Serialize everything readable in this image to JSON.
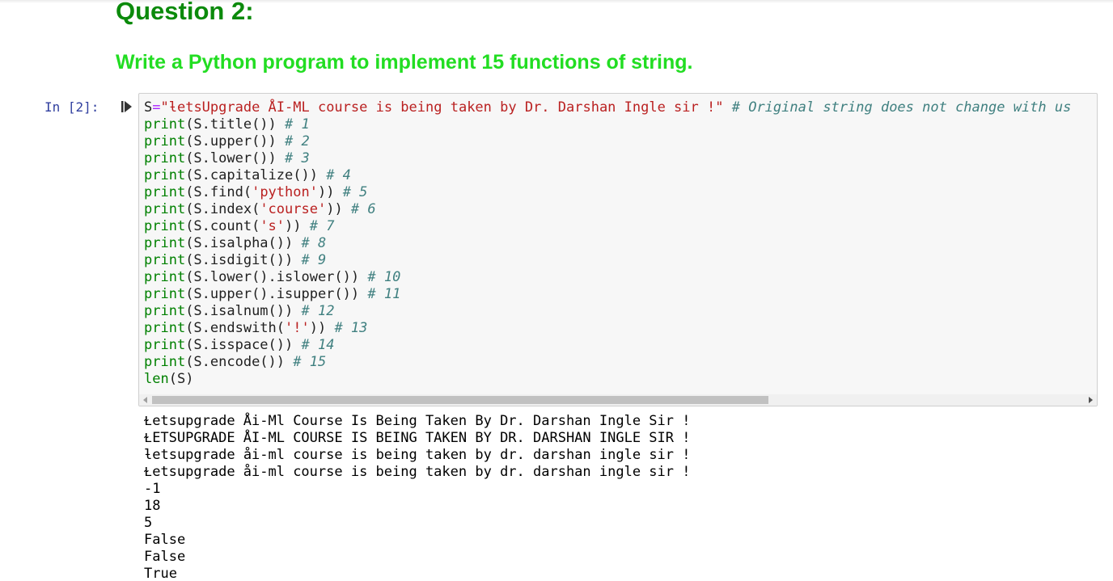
{
  "colors": {
    "heading_question": "#0b8a0b",
    "heading_task": "#22dd22",
    "prompt": "#303f9f",
    "keyword": "#aa22ff",
    "builtin": "#008000",
    "string": "#ba2121",
    "comment": "#408080",
    "text": "#212121",
    "output": "#000000"
  },
  "headings": {
    "question": "Question 2:",
    "task": "Write a Python program to implement 15 functions of string."
  },
  "cell": {
    "prompt": "In [2]:",
    "run_icon": "run-cell-icon",
    "code_lines": [
      [
        {
          "text": "S",
          "type": "text"
        },
        {
          "text": "=",
          "type": "keyword"
        },
        {
          "text": "\"ƚetsUpgrade ÅI-ML course is being taken by Dr. Darshan Ingle sir !\"",
          "type": "string"
        },
        {
          "text": " ",
          "type": "text"
        },
        {
          "text": "# Original string does not change with us",
          "type": "comment"
        }
      ],
      [
        {
          "text": "print",
          "type": "builtin"
        },
        {
          "text": "(S.title()) ",
          "type": "text"
        },
        {
          "text": "# 1",
          "type": "comment"
        }
      ],
      [
        {
          "text": "print",
          "type": "builtin"
        },
        {
          "text": "(S.upper()) ",
          "type": "text"
        },
        {
          "text": "# 2",
          "type": "comment"
        }
      ],
      [
        {
          "text": "print",
          "type": "builtin"
        },
        {
          "text": "(S.lower()) ",
          "type": "text"
        },
        {
          "text": "# 3",
          "type": "comment"
        }
      ],
      [
        {
          "text": "print",
          "type": "builtin"
        },
        {
          "text": "(S.capitalize()) ",
          "type": "text"
        },
        {
          "text": "# 4",
          "type": "comment"
        }
      ],
      [
        {
          "text": "print",
          "type": "builtin"
        },
        {
          "text": "(S.find(",
          "type": "text"
        },
        {
          "text": "'python'",
          "type": "string"
        },
        {
          "text": ")) ",
          "type": "text"
        },
        {
          "text": "# 5",
          "type": "comment"
        }
      ],
      [
        {
          "text": "print",
          "type": "builtin"
        },
        {
          "text": "(S.index(",
          "type": "text"
        },
        {
          "text": "'course'",
          "type": "string"
        },
        {
          "text": ")) ",
          "type": "text"
        },
        {
          "text": "# 6",
          "type": "comment"
        }
      ],
      [
        {
          "text": "print",
          "type": "builtin"
        },
        {
          "text": "(S.count(",
          "type": "text"
        },
        {
          "text": "'s'",
          "type": "string"
        },
        {
          "text": ")) ",
          "type": "text"
        },
        {
          "text": "# 7",
          "type": "comment"
        }
      ],
      [
        {
          "text": "print",
          "type": "builtin"
        },
        {
          "text": "(S.isalpha()) ",
          "type": "text"
        },
        {
          "text": "# 8",
          "type": "comment"
        }
      ],
      [
        {
          "text": "print",
          "type": "builtin"
        },
        {
          "text": "(S.isdigit()) ",
          "type": "text"
        },
        {
          "text": "# 9",
          "type": "comment"
        }
      ],
      [
        {
          "text": "print",
          "type": "builtin"
        },
        {
          "text": "(S.lower().islower()) ",
          "type": "text"
        },
        {
          "text": "# 10",
          "type": "comment"
        }
      ],
      [
        {
          "text": "print",
          "type": "builtin"
        },
        {
          "text": "(S.upper().isupper()) ",
          "type": "text"
        },
        {
          "text": "# 11",
          "type": "comment"
        }
      ],
      [
        {
          "text": "print",
          "type": "builtin"
        },
        {
          "text": "(S.isalnum()) ",
          "type": "text"
        },
        {
          "text": "# 12",
          "type": "comment"
        }
      ],
      [
        {
          "text": "print",
          "type": "builtin"
        },
        {
          "text": "(S.endswith(",
          "type": "text"
        },
        {
          "text": "'!'",
          "type": "string"
        },
        {
          "text": ")) ",
          "type": "text"
        },
        {
          "text": "# 13",
          "type": "comment"
        }
      ],
      [
        {
          "text": "print",
          "type": "builtin"
        },
        {
          "text": "(S.isspace()) ",
          "type": "text"
        },
        {
          "text": "# 14",
          "type": "comment"
        }
      ],
      [
        {
          "text": "print",
          "type": "builtin"
        },
        {
          "text": "(S.encode()) ",
          "type": "text"
        },
        {
          "text": "# 15",
          "type": "comment"
        }
      ],
      [
        {
          "text": "len",
          "type": "builtin"
        },
        {
          "text": "(S)",
          "type": "text"
        }
      ]
    ],
    "scrollbar": {
      "left_arrow": "scroll-left-icon",
      "right_arrow": "scroll-right-icon",
      "visible_fraction": 0.66
    }
  },
  "output": {
    "lines": [
      "Ɫetsupgrade Åi-Ml Course Is Being Taken By Dr. Darshan Ingle Sir !",
      "ⱢETSUPGRADE ÅI-ML COURSE IS BEING TAKEN BY DR. DARSHAN INGLE SIR !",
      "ƚetsupgrade åi-ml course is being taken by dr. darshan ingle sir !",
      "Ɫetsupgrade åi-ml course is being taken by dr. darshan ingle sir !",
      "-1",
      "18",
      "5",
      "False",
      "False",
      "True"
    ]
  }
}
